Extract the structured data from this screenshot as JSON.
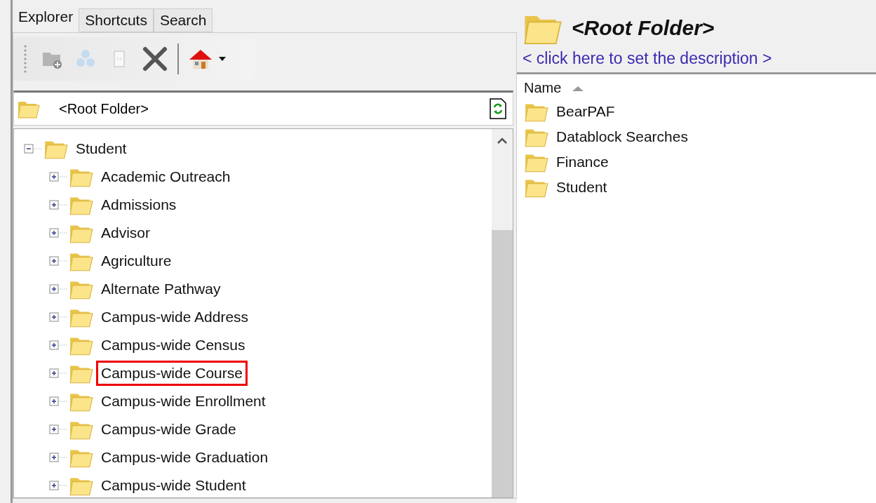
{
  "tabs": [
    {
      "label": "Explorer",
      "selected": true
    },
    {
      "label": "Shortcuts",
      "selected": false
    },
    {
      "label": "Search",
      "selected": false
    }
  ],
  "toolbar": [
    {
      "kind": "new-folder",
      "disabled": true
    },
    {
      "kind": "share",
      "disabled": true
    },
    {
      "kind": "document",
      "disabled": true
    },
    {
      "kind": "delete",
      "disabled": false
    },
    {
      "kind": "separator"
    },
    {
      "kind": "home",
      "disabled": false
    }
  ],
  "path": {
    "value": "<Root Folder>"
  },
  "tree": [
    {
      "label": "Student",
      "expanded": true,
      "highlighted": false,
      "children": [
        {
          "label": "Academic Outreach",
          "expanded": false,
          "highlighted": false
        },
        {
          "label": "Admissions",
          "expanded": false,
          "highlighted": false
        },
        {
          "label": "Advisor",
          "expanded": false,
          "highlighted": false
        },
        {
          "label": "Agriculture",
          "expanded": false,
          "highlighted": false
        },
        {
          "label": "Alternate Pathway",
          "expanded": false,
          "highlighted": false
        },
        {
          "label": "Campus-wide Address",
          "expanded": false,
          "highlighted": false
        },
        {
          "label": "Campus-wide Census",
          "expanded": false,
          "highlighted": false
        },
        {
          "label": "Campus-wide Course",
          "expanded": false,
          "highlighted": true
        },
        {
          "label": "Campus-wide Enrollment",
          "expanded": false,
          "highlighted": false
        },
        {
          "label": "Campus-wide Grade",
          "expanded": false,
          "highlighted": false
        },
        {
          "label": "Campus-wide Graduation",
          "expanded": false,
          "highlighted": false
        },
        {
          "label": "Campus-wide Student",
          "expanded": false,
          "highlighted": false
        }
      ]
    }
  ],
  "folder_header": {
    "title": "<Root Folder>",
    "description_link": "< click here to set the description >"
  },
  "list": {
    "column": "Name",
    "items": [
      "BearPAF",
      "Datablock Searches",
      "Finance",
      "Student"
    ]
  }
}
